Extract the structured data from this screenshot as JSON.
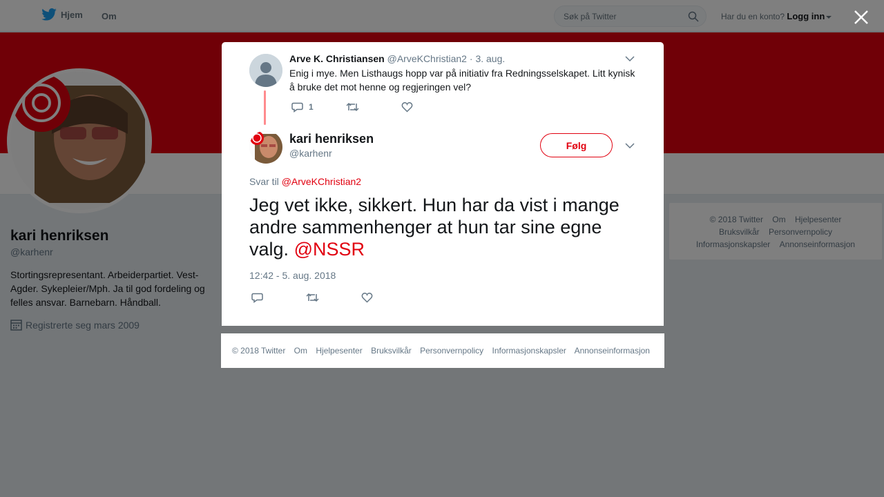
{
  "topbar": {
    "home_label": "Hjem",
    "about_label": "Om",
    "search_placeholder": "Søk på Twitter",
    "login_prompt": "Har du en konto?",
    "login_label": "Logg inn"
  },
  "colors": {
    "accent": "#e1000f",
    "thread_line": "#ff8b8e",
    "muted": "#657786"
  },
  "profile": {
    "name": "kari henriksen",
    "handle": "@karhenr",
    "bio": "Stortingsrepresentant. Arbeiderpartiet. Vest-Agder. Sykepleier/Mph. Ja til god fordeling og felles ansvar. Barnebarn. Håndball.",
    "joined": "Registrerte seg mars 2009"
  },
  "side_footer": {
    "links": [
      "© 2018 Twitter",
      "Om",
      "Hjelpesenter",
      "Bruksvilkår",
      "Personvernpolicy",
      "Informasjonskapsler",
      "Annonseinformasjon"
    ]
  },
  "modal": {
    "context_tweet": {
      "name": "Arve K. Christiansen",
      "handle": "@ArveKChristian2",
      "separator": "·",
      "date": "3. aug.",
      "text": "Enig i mye. Men Listhaugs hopp var på initiativ fra Redningsselskapet. Litt kynisk å bruke det mot henne og regjeringen vel?",
      "reply_count": "1"
    },
    "main_tweet": {
      "name": "kari henriksen",
      "handle": "@karhenr",
      "follow_label": "Følg",
      "reply_to_prefix": "Svar til",
      "reply_to_handle": "@ArveKChristian2",
      "text": "Jeg vet ikke, sikkert. Hun har da vist i mange andre sammenhenger at hun tar sine egne valg.",
      "text_mention": "@NSSR",
      "timestamp": "12:42 - 5. aug. 2018"
    },
    "footer_links": [
      "© 2018 Twitter",
      "Om",
      "Hjelpesenter",
      "Bruksvilkår",
      "Personvernpolicy",
      "Informasjonskapsler",
      "Annonseinformasjon"
    ]
  }
}
